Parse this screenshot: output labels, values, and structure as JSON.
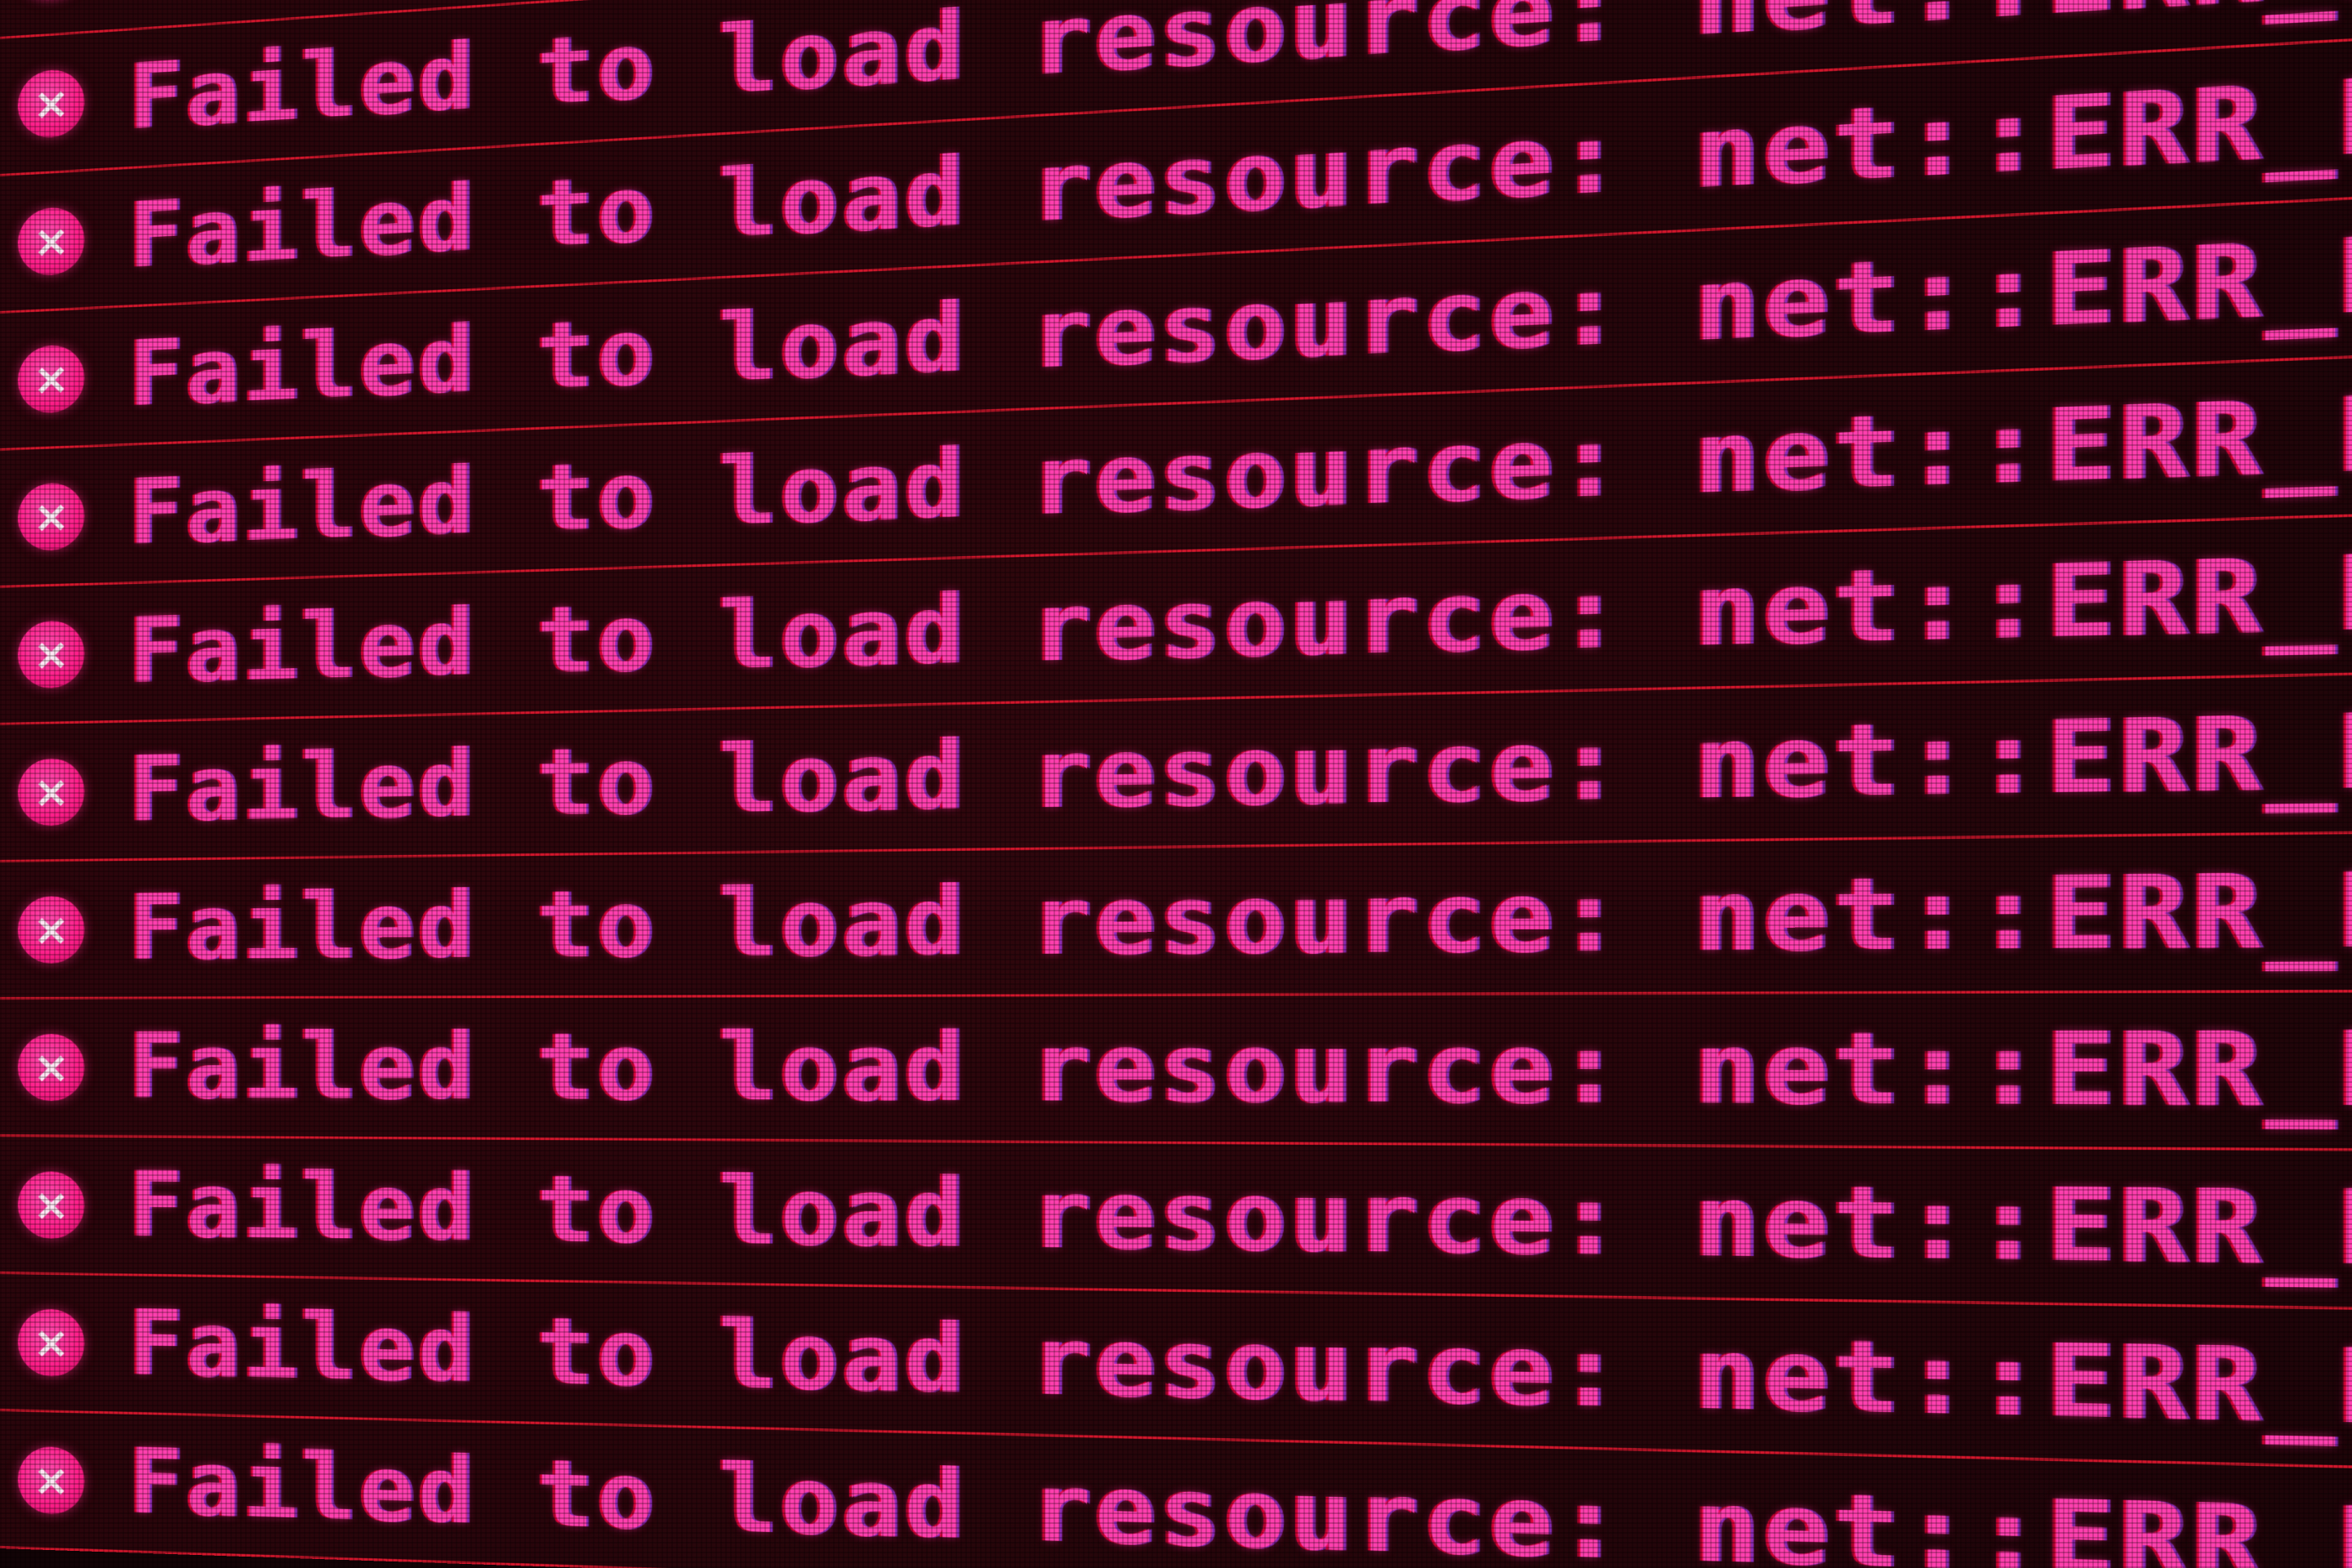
{
  "console": {
    "error_icon": "error-x-icon",
    "error_glyph": "×",
    "colors": {
      "text": "#ff3fae",
      "icon": "#ff1f8a",
      "divider": "#d2162c",
      "background": "#1a0508"
    },
    "messages": [
      "Failed to load resource: net::ERR_BLOCKED_BY_AD",
      "Failed to load resource: net::ERR_BLOCKED_BY_AD",
      "Failed to load resource: net::ERR_BLOCKED_BY_AD",
      "Failed to load resource: net::ERR_BLOCKED_BY_AD",
      "Failed to load resource: net::ERR_BLOCKED_BY_AD",
      "Failed to load resource: net::ERR_BLOCKED_BY_AD",
      "Failed to load resource: net::ERR_BLOCKED_BY_AD",
      "Failed to load resource: net::ERR_BLOCKED_BY_AD",
      "Failed to load resource: net::ERR_BLOCKED_BY_AD",
      "Failed to load resource: net::ERR_BLOCKED_BY_AD",
      "Failed to load resource: net::ERR_BLOCKED_BY_AD",
      "Failed to load resource: net::ERR_BLOCKED_BY_AD"
    ]
  }
}
